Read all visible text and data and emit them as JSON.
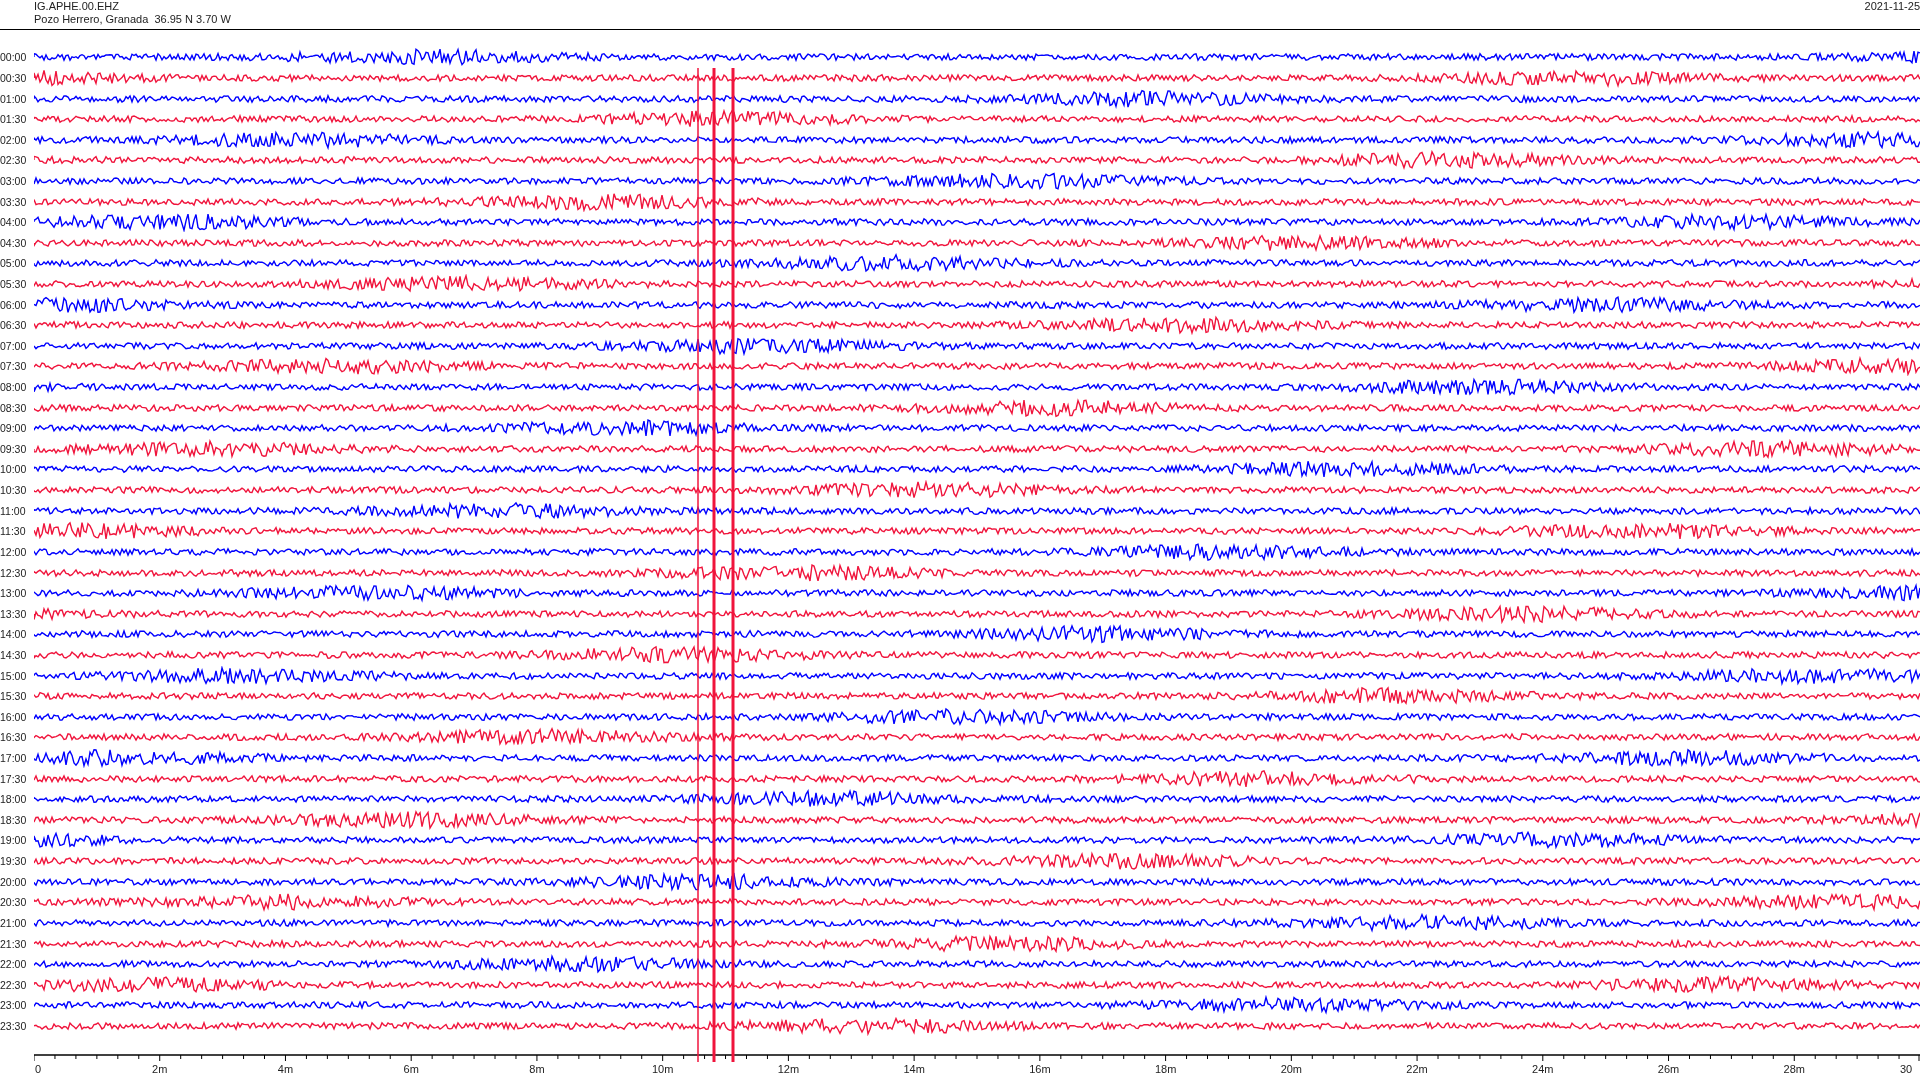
{
  "header": {
    "station": "IG.APHE.00.EHZ",
    "location": "Pozo Herrero, Granada  36.95 N 3.70 W",
    "date": "2021-11-25"
  },
  "rows": [
    {
      "label": "00:00",
      "color": "#0000ff"
    },
    {
      "label": "00:30",
      "color": "#f0143c"
    },
    {
      "label": "01:00",
      "color": "#0000ff"
    },
    {
      "label": "01:30",
      "color": "#f0143c"
    },
    {
      "label": "02:00",
      "color": "#0000ff"
    },
    {
      "label": "02:30",
      "color": "#f0143c"
    },
    {
      "label": "03:00",
      "color": "#0000ff"
    },
    {
      "label": "03:30",
      "color": "#f0143c"
    },
    {
      "label": "04:00",
      "color": "#0000ff"
    },
    {
      "label": "04:30",
      "color": "#f0143c"
    },
    {
      "label": "05:00",
      "color": "#0000ff"
    },
    {
      "label": "05:30",
      "color": "#f0143c"
    },
    {
      "label": "06:00",
      "color": "#0000ff"
    },
    {
      "label": "06:30",
      "color": "#f0143c"
    },
    {
      "label": "07:00",
      "color": "#0000ff"
    },
    {
      "label": "07:30",
      "color": "#f0143c"
    },
    {
      "label": "08:00",
      "color": "#0000ff"
    },
    {
      "label": "08:30",
      "color": "#f0143c"
    },
    {
      "label": "09:00",
      "color": "#0000ff"
    },
    {
      "label": "09:30",
      "color": "#f0143c"
    },
    {
      "label": "10:00",
      "color": "#0000ff"
    },
    {
      "label": "10:30",
      "color": "#f0143c"
    },
    {
      "label": "11:00",
      "color": "#0000ff"
    },
    {
      "label": "11:30",
      "color": "#f0143c"
    },
    {
      "label": "12:00",
      "color": "#0000ff"
    },
    {
      "label": "12:30",
      "color": "#f0143c"
    },
    {
      "label": "13:00",
      "color": "#0000ff"
    },
    {
      "label": "13:30",
      "color": "#f0143c"
    },
    {
      "label": "14:00",
      "color": "#0000ff"
    },
    {
      "label": "14:30",
      "color": "#f0143c"
    },
    {
      "label": "15:00",
      "color": "#0000ff"
    },
    {
      "label": "15:30",
      "color": "#f0143c"
    },
    {
      "label": "16:00",
      "color": "#0000ff"
    },
    {
      "label": "16:30",
      "color": "#f0143c"
    },
    {
      "label": "17:00",
      "color": "#0000ff"
    },
    {
      "label": "17:30",
      "color": "#f0143c"
    },
    {
      "label": "18:00",
      "color": "#0000ff"
    },
    {
      "label": "18:30",
      "color": "#f0143c"
    },
    {
      "label": "19:00",
      "color": "#0000ff"
    },
    {
      "label": "19:30",
      "color": "#f0143c"
    },
    {
      "label": "20:00",
      "color": "#0000ff"
    },
    {
      "label": "20:30",
      "color": "#f0143c"
    },
    {
      "label": "21:00",
      "color": "#0000ff"
    },
    {
      "label": "21:30",
      "color": "#f0143c"
    },
    {
      "label": "22:00",
      "color": "#0000ff"
    },
    {
      "label": "22:30",
      "color": "#f0143c"
    },
    {
      "label": "23:00",
      "color": "#0000ff"
    },
    {
      "label": "23:30",
      "color": "#f0143c"
    }
  ],
  "x_axis": {
    "ticks": [
      "0",
      "2m",
      "4m",
      "6m",
      "8m",
      "10m",
      "12m",
      "14m",
      "16m",
      "18m",
      "20m",
      "22m",
      "24m",
      "26m",
      "28m",
      "30"
    ]
  }
}
